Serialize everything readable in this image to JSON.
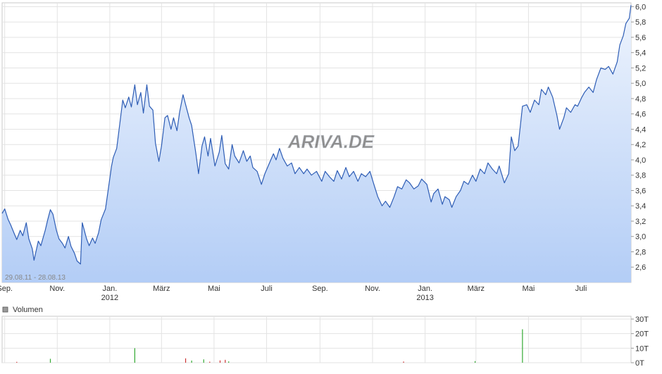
{
  "chart_data": {
    "type": "area",
    "range_label": "29.08.11 - 28.08.13",
    "watermark": "ARIVA.DE",
    "price": {
      "y_ticks": [
        "6,0",
        "5,8",
        "5,6",
        "5,4",
        "5,2",
        "5,0",
        "4,8",
        "4,6",
        "4,4",
        "4,2",
        "4,0",
        "3,8",
        "3,6",
        "3,4",
        "3,2",
        "3,0",
        "2,8",
        "2,6"
      ],
      "ylim": [
        2.4,
        6.05
      ],
      "grid": true,
      "line_color": "#2e5db5",
      "fill_top": "#eef4fd",
      "fill_bottom": "#b3cdf6",
      "points": [
        [
          "2011-08-29",
          3.3
        ],
        [
          "2011-09-01",
          3.36
        ],
        [
          "2011-09-05",
          3.22
        ],
        [
          "2011-09-08",
          3.15
        ],
        [
          "2011-09-12",
          3.04
        ],
        [
          "2011-09-15",
          2.96
        ],
        [
          "2011-09-19",
          3.08
        ],
        [
          "2011-09-22",
          3.01
        ],
        [
          "2011-09-26",
          3.18
        ],
        [
          "2011-09-29",
          2.97
        ],
        [
          "2011-10-03",
          2.84
        ],
        [
          "2011-10-05",
          2.69
        ],
        [
          "2011-10-10",
          2.94
        ],
        [
          "2011-10-13",
          2.88
        ],
        [
          "2011-10-18",
          3.08
        ],
        [
          "2011-10-21",
          3.22
        ],
        [
          "2011-10-24",
          3.35
        ],
        [
          "2011-10-27",
          3.29
        ],
        [
          "2011-10-31",
          3.08
        ],
        [
          "2011-11-03",
          2.97
        ],
        [
          "2011-11-07",
          2.91
        ],
        [
          "2011-11-10",
          2.85
        ],
        [
          "2011-11-14",
          3.0
        ],
        [
          "2011-11-17",
          2.87
        ],
        [
          "2011-11-21",
          2.78
        ],
        [
          "2011-11-24",
          2.68
        ],
        [
          "2011-11-28",
          2.64
        ],
        [
          "2011-11-30",
          3.18
        ],
        [
          "2011-12-05",
          2.97
        ],
        [
          "2011-12-08",
          2.88
        ],
        [
          "2011-12-12",
          2.98
        ],
        [
          "2011-12-15",
          2.91
        ],
        [
          "2011-12-19",
          3.05
        ],
        [
          "2011-12-22",
          3.22
        ],
        [
          "2011-12-27",
          3.36
        ],
        [
          "2011-12-30",
          3.6
        ],
        [
          "2012-01-03",
          3.92
        ],
        [
          "2012-01-05",
          4.03
        ],
        [
          "2012-01-09",
          4.15
        ],
        [
          "2012-01-12",
          4.42
        ],
        [
          "2012-01-16",
          4.78
        ],
        [
          "2012-01-19",
          4.68
        ],
        [
          "2012-01-23",
          4.82
        ],
        [
          "2012-01-26",
          4.69
        ],
        [
          "2012-01-30",
          4.98
        ],
        [
          "2012-02-02",
          4.72
        ],
        [
          "2012-02-06",
          4.88
        ],
        [
          "2012-02-09",
          4.61
        ],
        [
          "2012-02-13",
          4.98
        ],
        [
          "2012-02-16",
          4.7
        ],
        [
          "2012-02-20",
          4.65
        ],
        [
          "2012-02-23",
          4.22
        ],
        [
          "2012-02-27",
          3.98
        ],
        [
          "2012-03-01",
          4.18
        ],
        [
          "2012-03-05",
          4.55
        ],
        [
          "2012-03-08",
          4.58
        ],
        [
          "2012-03-12",
          4.4
        ],
        [
          "2012-03-15",
          4.55
        ],
        [
          "2012-03-19",
          4.38
        ],
        [
          "2012-03-22",
          4.62
        ],
        [
          "2012-03-26",
          4.85
        ],
        [
          "2012-03-29",
          4.72
        ],
        [
          "2012-04-02",
          4.55
        ],
        [
          "2012-04-05",
          4.45
        ],
        [
          "2012-04-10",
          4.08
        ],
        [
          "2012-04-13",
          3.82
        ],
        [
          "2012-04-17",
          4.18
        ],
        [
          "2012-04-20",
          4.3
        ],
        [
          "2012-04-24",
          4.05
        ],
        [
          "2012-04-27",
          4.28
        ],
        [
          "2012-05-02",
          3.92
        ],
        [
          "2012-05-07",
          4.1
        ],
        [
          "2012-05-10",
          4.32
        ],
        [
          "2012-05-14",
          3.95
        ],
        [
          "2012-05-18",
          3.88
        ],
        [
          "2012-05-22",
          4.2
        ],
        [
          "2012-05-25",
          4.05
        ],
        [
          "2012-05-30",
          3.96
        ],
        [
          "2012-06-04",
          4.12
        ],
        [
          "2012-06-08",
          3.98
        ],
        [
          "2012-06-12",
          4.05
        ],
        [
          "2012-06-15",
          3.9
        ],
        [
          "2012-06-20",
          3.85
        ],
        [
          "2012-06-25",
          3.68
        ],
        [
          "2012-06-29",
          3.82
        ],
        [
          "2012-07-04",
          3.95
        ],
        [
          "2012-07-09",
          4.08
        ],
        [
          "2012-07-12",
          4.0
        ],
        [
          "2012-07-16",
          4.15
        ],
        [
          "2012-07-20",
          4.02
        ],
        [
          "2012-07-25",
          3.92
        ],
        [
          "2012-07-30",
          3.96
        ],
        [
          "2012-08-03",
          3.82
        ],
        [
          "2012-08-08",
          3.9
        ],
        [
          "2012-08-13",
          3.82
        ],
        [
          "2012-08-17",
          3.88
        ],
        [
          "2012-08-22",
          3.8
        ],
        [
          "2012-08-28",
          3.85
        ],
        [
          "2012-09-03",
          3.72
        ],
        [
          "2012-09-07",
          3.85
        ],
        [
          "2012-09-12",
          3.78
        ],
        [
          "2012-09-17",
          3.72
        ],
        [
          "2012-09-21",
          3.86
        ],
        [
          "2012-09-26",
          3.75
        ],
        [
          "2012-10-01",
          3.9
        ],
        [
          "2012-10-05",
          3.78
        ],
        [
          "2012-10-10",
          3.85
        ],
        [
          "2012-10-15",
          3.72
        ],
        [
          "2012-10-19",
          3.82
        ],
        [
          "2012-10-24",
          3.78
        ],
        [
          "2012-10-29",
          3.85
        ],
        [
          "2012-11-02",
          3.7
        ],
        [
          "2012-11-07",
          3.52
        ],
        [
          "2012-11-12",
          3.4
        ],
        [
          "2012-11-16",
          3.46
        ],
        [
          "2012-11-21",
          3.38
        ],
        [
          "2012-11-26",
          3.52
        ],
        [
          "2012-11-30",
          3.65
        ],
        [
          "2012-12-05",
          3.62
        ],
        [
          "2012-12-10",
          3.74
        ],
        [
          "2012-12-14",
          3.7
        ],
        [
          "2012-12-19",
          3.62
        ],
        [
          "2012-12-24",
          3.66
        ],
        [
          "2012-12-28",
          3.75
        ],
        [
          "2013-01-03",
          3.68
        ],
        [
          "2013-01-08",
          3.45
        ],
        [
          "2013-01-11",
          3.56
        ],
        [
          "2013-01-16",
          3.62
        ],
        [
          "2013-01-21",
          3.42
        ],
        [
          "2013-01-24",
          3.52
        ],
        [
          "2013-01-29",
          3.48
        ],
        [
          "2013-02-01",
          3.38
        ],
        [
          "2013-02-06",
          3.52
        ],
        [
          "2013-02-11",
          3.6
        ],
        [
          "2013-02-15",
          3.72
        ],
        [
          "2013-02-20",
          3.68
        ],
        [
          "2013-02-25",
          3.8
        ],
        [
          "2013-03-01",
          3.72
        ],
        [
          "2013-03-06",
          3.88
        ],
        [
          "2013-03-11",
          3.82
        ],
        [
          "2013-03-15",
          3.96
        ],
        [
          "2013-03-20",
          3.88
        ],
        [
          "2013-03-25",
          3.82
        ],
        [
          "2013-03-28",
          3.92
        ],
        [
          "2013-04-03",
          3.7
        ],
        [
          "2013-04-08",
          3.82
        ],
        [
          "2013-04-11",
          4.3
        ],
        [
          "2013-04-15",
          4.12
        ],
        [
          "2013-04-19",
          4.18
        ],
        [
          "2013-04-24",
          4.7
        ],
        [
          "2013-04-29",
          4.72
        ],
        [
          "2013-05-03",
          4.62
        ],
        [
          "2013-05-08",
          4.78
        ],
        [
          "2013-05-13",
          4.72
        ],
        [
          "2013-05-16",
          4.92
        ],
        [
          "2013-05-21",
          4.85
        ],
        [
          "2013-05-24",
          4.95
        ],
        [
          "2013-05-29",
          4.82
        ],
        [
          "2013-06-03",
          4.58
        ],
        [
          "2013-06-06",
          4.4
        ],
        [
          "2013-06-11",
          4.55
        ],
        [
          "2013-06-14",
          4.68
        ],
        [
          "2013-06-19",
          4.62
        ],
        [
          "2013-06-24",
          4.72
        ],
        [
          "2013-06-27",
          4.7
        ],
        [
          "2013-07-02",
          4.82
        ],
        [
          "2013-07-05",
          4.88
        ],
        [
          "2013-07-10",
          4.95
        ],
        [
          "2013-07-15",
          4.88
        ],
        [
          "2013-07-19",
          5.05
        ],
        [
          "2013-07-24",
          5.2
        ],
        [
          "2013-07-29",
          5.18
        ],
        [
          "2013-08-02",
          5.22
        ],
        [
          "2013-08-07",
          5.12
        ],
        [
          "2013-08-12",
          5.28
        ],
        [
          "2013-08-15",
          5.5
        ],
        [
          "2013-08-19",
          5.62
        ],
        [
          "2013-08-22",
          5.78
        ],
        [
          "2013-08-26",
          5.85
        ],
        [
          "2013-08-28",
          6.02
        ]
      ]
    },
    "x_ticks": [
      {
        "date": "2011-09-01",
        "label": "Sep."
      },
      {
        "date": "2011-11-01",
        "label": "Nov."
      },
      {
        "date": "2012-01-01",
        "label": "Jan.",
        "year": "2012"
      },
      {
        "date": "2012-03-01",
        "label": "März"
      },
      {
        "date": "2012-05-01",
        "label": "Mai"
      },
      {
        "date": "2012-07-01",
        "label": "Juli"
      },
      {
        "date": "2012-09-01",
        "label": "Sep."
      },
      {
        "date": "2012-11-01",
        "label": "Nov."
      },
      {
        "date": "2013-01-01",
        "label": "Jan.",
        "year": "2013"
      },
      {
        "date": "2013-03-01",
        "label": "März"
      },
      {
        "date": "2013-05-01",
        "label": "Mai"
      },
      {
        "date": "2013-07-01",
        "label": "Juli"
      }
    ],
    "volume": {
      "legend": "Volumen",
      "y_ticks": [
        "30T",
        "20T",
        "10T",
        "0T"
      ],
      "ylim": [
        0,
        30000
      ],
      "up_color": "#33aa33",
      "down_color": "#cc3333",
      "bars": [
        {
          "date": "2011-09-15",
          "value": 600,
          "dir": "down"
        },
        {
          "date": "2011-10-24",
          "value": 2700,
          "dir": "up"
        },
        {
          "date": "2012-01-30",
          "value": 10000,
          "dir": "up"
        },
        {
          "date": "2012-03-29",
          "value": 3000,
          "dir": "down"
        },
        {
          "date": "2012-04-05",
          "value": 1500,
          "dir": "up"
        },
        {
          "date": "2012-04-19",
          "value": 2300,
          "dir": "up"
        },
        {
          "date": "2012-04-26",
          "value": 700,
          "dir": "down"
        },
        {
          "date": "2012-05-08",
          "value": 1600,
          "dir": "down"
        },
        {
          "date": "2012-05-14",
          "value": 2000,
          "dir": "down"
        },
        {
          "date": "2012-05-18",
          "value": 900,
          "dir": "up"
        },
        {
          "date": "2012-12-07",
          "value": 800,
          "dir": "down"
        },
        {
          "date": "2013-02-28",
          "value": 1100,
          "dir": "up"
        },
        {
          "date": "2013-04-24",
          "value": 23000,
          "dir": "up"
        }
      ]
    }
  }
}
